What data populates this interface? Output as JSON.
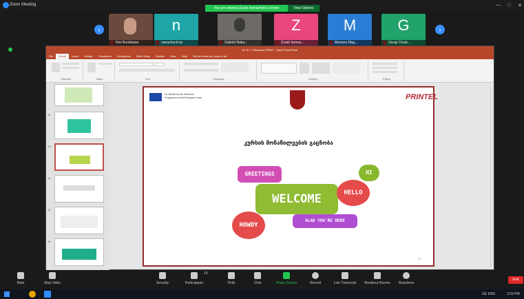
{
  "app": {
    "title": "Zoom Meeting"
  },
  "notice": {
    "text": "You are viewing Zurab Iremashvili's screen",
    "view_options": "View Options"
  },
  "participants": [
    {
      "name": "Nini Burdiladze",
      "letter": ""
    },
    {
      "name": "nanachechi.tp",
      "letter": "n"
    },
    {
      "name": "Gabriel Naka...",
      "letter": ""
    },
    {
      "name": "Zurab Iremas...",
      "letter": "Z"
    },
    {
      "name": "Mariana Mag...",
      "letter": "M"
    },
    {
      "name": "Giorgi Chubi...",
      "letter": "G"
    }
  ],
  "ppt": {
    "title": "M. M. T. Efficiency PRINT...  Save  PowerPoint",
    "tabs": [
      "File",
      "Home",
      "Insert",
      "Design",
      "Transitions",
      "Animations",
      "Slide Show",
      "Review",
      "View",
      "Help",
      "Tell me what you want to do"
    ],
    "ribbon_groups": [
      "Clipboard",
      "Slides",
      "Font",
      "Paragraph",
      "Drawing",
      "Editing"
    ],
    "thumb_numbers": [
      "",
      "12",
      "13",
      "14",
      "15",
      "16"
    ]
  },
  "slide": {
    "cofunded": "Co-funded by the Erasmus+ Programme of the European Union",
    "brand": "PRINTEL",
    "heading": "კურსის მონაწილეების გაცნობა",
    "bubbles": {
      "greetings": "GREETINGS",
      "hi": "HI",
      "welcome": "WELCOME",
      "hello": "HELLO",
      "howdy": "HOWDY",
      "glad": "GLAD YOU'RE HERE"
    },
    "page_number": "20"
  },
  "toolbar": {
    "mute": "Mute",
    "stop_video": "Stop Video",
    "security": "Security",
    "participants": "Participants",
    "participants_count": "15",
    "polls": "Polls",
    "chat": "Chat",
    "share_screen": "Share Screen",
    "record": "Record",
    "live_transcript": "Live Transcript",
    "breakout": "Breakout Rooms",
    "reactions": "Reactions",
    "end": "End"
  },
  "taskbar": {
    "lang": "GE ENG",
    "time": "3:29 PM"
  }
}
